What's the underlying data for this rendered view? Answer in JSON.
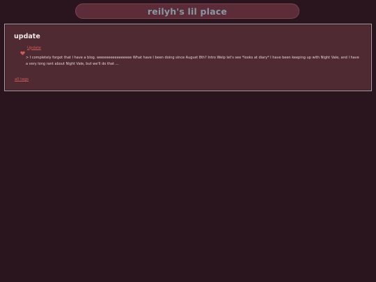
{
  "header": {
    "site_title": "reilyh's lil place"
  },
  "tag_page": {
    "title": "update",
    "posts": [
      {
        "icon": "heart-icon",
        "title": "Update",
        "excerpt": "> I completely forgot that I have a blog. weeeeeeeeeeeeeee What have I been doing since August 8th? Intro Welp let's see *looks at diary* I have been keeping up with Night Vale, and I have a very long rant about Night Vale, but we'll do that ..."
      }
    ],
    "all_tags_label": "all tags"
  },
  "colors": {
    "background": "#2a151e",
    "header_bg": "#5c2c38",
    "box_bg": "#4f2a33",
    "link": "#d15a5a",
    "title_text": "#8a97a6"
  }
}
